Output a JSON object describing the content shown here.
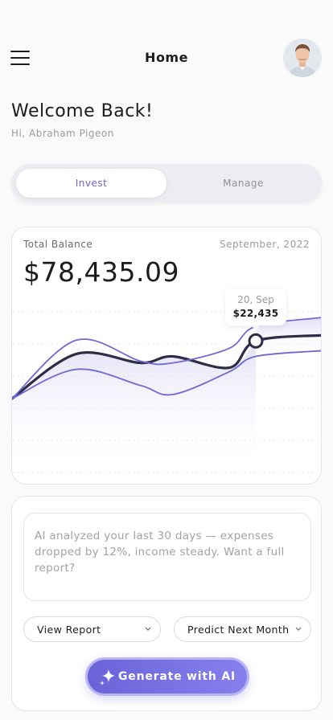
{
  "header": {
    "title": "Home"
  },
  "welcome": {
    "title": "Welcome Back!",
    "greeting": "Hi, Abraham Pigeon"
  },
  "tabs": [
    {
      "label": "Invest",
      "active": true
    },
    {
      "label": "Manage",
      "active": false
    }
  ],
  "balance": {
    "label": "Total Balance",
    "period": "September, 2022",
    "value": "$78,435.09",
    "tooltip": {
      "date": "20, Sep",
      "value": "$22,435"
    }
  },
  "chart_data": {
    "type": "area",
    "series": [
      {
        "values": [
          0,
          0.55,
          0.44,
          0.52,
          0.38,
          0.71,
          0.78
        ],
        "color": "#2f2c48"
      },
      {
        "values": [
          0,
          0.72,
          0.46,
          0.44,
          0.62,
          0.89,
          1.0
        ],
        "color": "#6e69d4"
      },
      {
        "values": [
          0,
          0.36,
          0.16,
          0.05,
          0.33,
          0.52,
          0.59
        ],
        "color": "#6e69d4"
      }
    ],
    "highlight_index": 5,
    "accent": "#6e69d4",
    "grid": true
  },
  "ai": {
    "message": "AI analyzed your last 30 days — expenses dropped by 12%, income steady. Want a full report?",
    "chip1": "View Report",
    "chip2": "Predict Next Month",
    "generate": "Generate with AI"
  }
}
